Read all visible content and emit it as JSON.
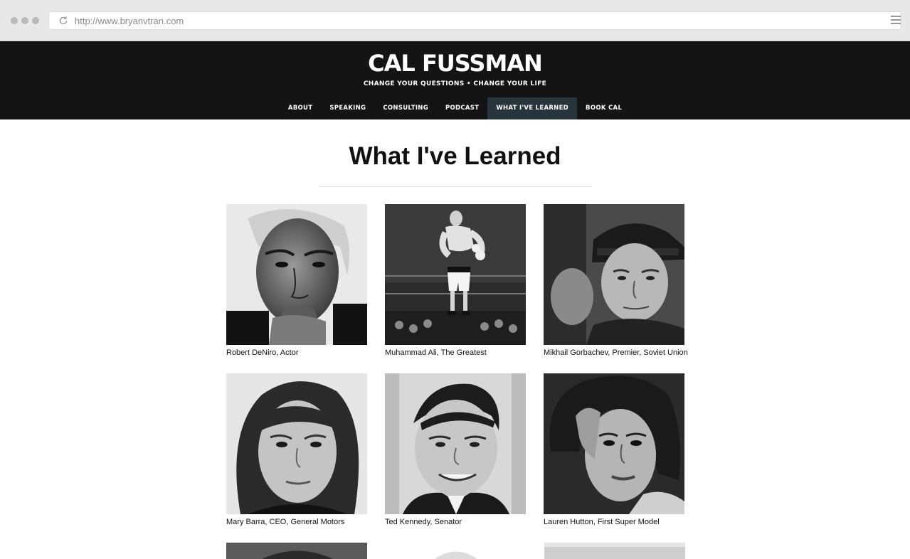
{
  "browser": {
    "url": "http://www.bryanvtran.com"
  },
  "site": {
    "logo": "CAL FUSSMAN",
    "tagline": "CHANGE YOUR QUESTIONS • CHANGE YOUR LIFE",
    "nav": [
      {
        "label": "ABOUT",
        "active": false
      },
      {
        "label": "SPEAKING",
        "active": false
      },
      {
        "label": "CONSULTING",
        "active": false
      },
      {
        "label": "PODCAST",
        "active": false
      },
      {
        "label": "WHAT I'VE LEARNED",
        "active": true
      },
      {
        "label": "BOOK CAL",
        "active": false
      }
    ]
  },
  "main": {
    "title": "What I've Learned",
    "cards": [
      {
        "caption": "Robert DeNiro, Actor"
      },
      {
        "caption": "Muhammad Ali, The Greatest"
      },
      {
        "caption": "Mikhail Gorbachev, Premier, Soviet Union"
      },
      {
        "caption": "Mary Barra, CEO, General Motors"
      },
      {
        "caption": "Ted Kennedy, Senator"
      },
      {
        "caption": "Lauren Hutton, First Super Model"
      }
    ]
  },
  "colors": {
    "header_bg": "#141414",
    "nav_active_bg": "#27343b",
    "chrome_bg": "#e8e8e8"
  }
}
